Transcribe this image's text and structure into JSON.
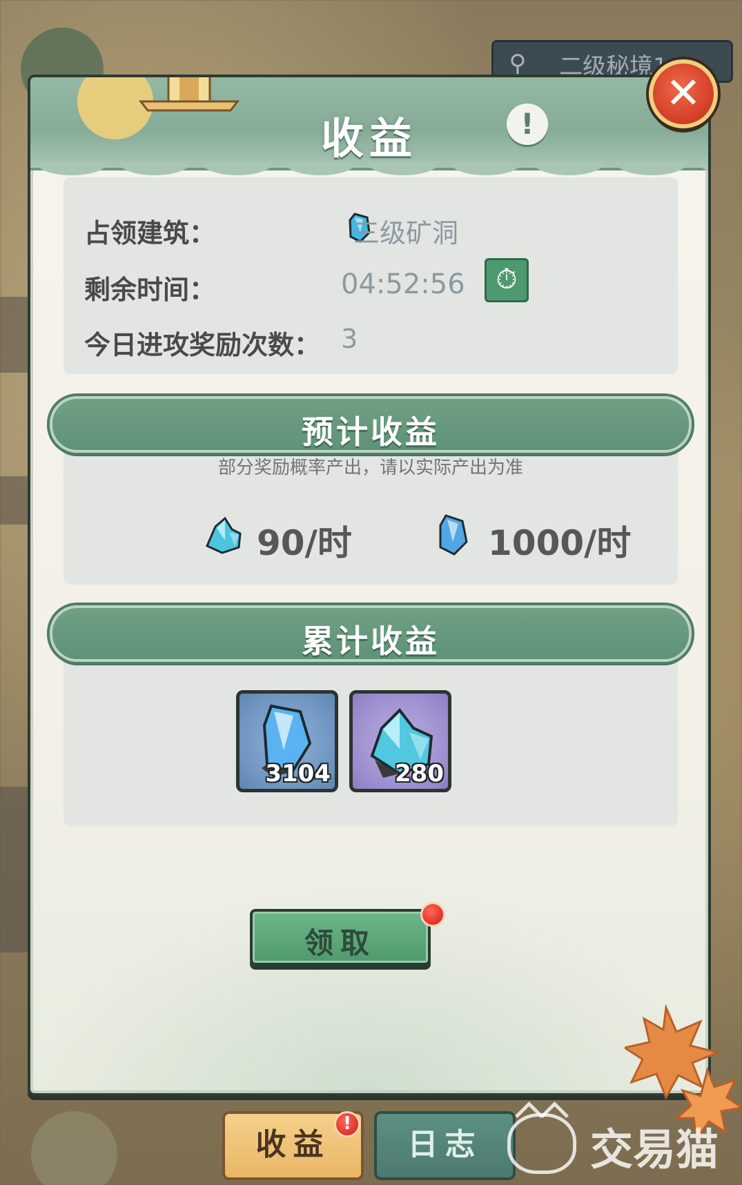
{
  "background": {
    "search_label": "二级秘境1"
  },
  "dialog": {
    "title": "收益",
    "info_rows": [
      {
        "label": "占领建筑：",
        "value": "三级矿洞"
      },
      {
        "label": "剩余时间：",
        "value": "04:52:56"
      },
      {
        "label": "今日进攻奖励次数：",
        "value": "3"
      }
    ],
    "estimated": {
      "header": "预计收益",
      "note": "部分奖励概率产出，请以实际产出为准",
      "rates": [
        {
          "icon": "crystal-cluster-icon",
          "value": "90/时"
        },
        {
          "icon": "crystal-gem-icon",
          "value": "1000/时"
        }
      ]
    },
    "accumulated": {
      "header": "累计收益",
      "items": [
        {
          "icon": "crystal-gem-icon",
          "count": "3104",
          "frame_color": "#6f95c0"
        },
        {
          "icon": "crystal-cluster-icon",
          "count": "280",
          "frame_color": "#9d8fcf"
        }
      ]
    },
    "claim_label": "领取"
  },
  "tabs": [
    {
      "label": "收益",
      "active": true,
      "badge": "!"
    },
    {
      "label": "日志",
      "active": false
    }
  ],
  "watermark": {
    "text": "交易猫"
  },
  "colors": {
    "header_green": "#86ac97",
    "section_green": "#5f9277",
    "claim_green": "#4f9a6d",
    "close_red": "#d7432a",
    "gold_border": "#f2cf7c"
  }
}
